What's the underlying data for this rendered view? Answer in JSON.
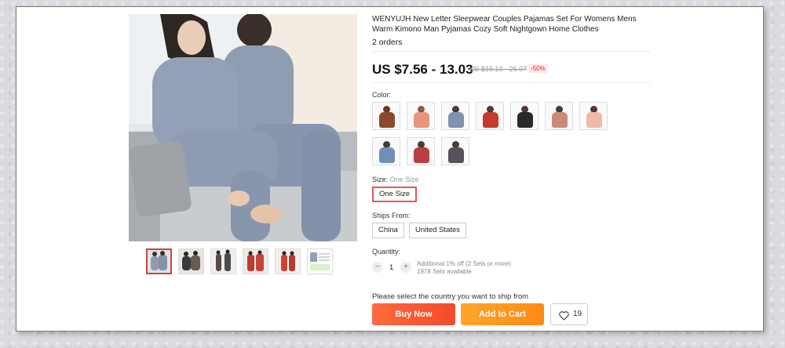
{
  "product": {
    "title": "WENYUJH New Letter Sleepwear Couples Pajamas Set For Womens Mens Warm Kimono Man Pyjamas Cozy Soft Nightgown Home Clothes",
    "orders": "2 orders",
    "price": "US $7.56 - 13.03",
    "original_price": "US $15.13 - 26.07",
    "discount": "-50%"
  },
  "color": {
    "label": "Color:",
    "swatches": [
      {
        "name": "brown",
        "color": "#8a4a2a"
      },
      {
        "name": "salmon",
        "color": "#e8957a"
      },
      {
        "name": "blue-grey",
        "color": "#7e93ad"
      },
      {
        "name": "red",
        "color": "#c43a2b"
      },
      {
        "name": "black",
        "color": "#2a2a2a"
      },
      {
        "name": "pink-beige",
        "color": "#c98b78"
      },
      {
        "name": "light-pink",
        "color": "#efb9a8"
      },
      {
        "name": "blue",
        "color": "#6f8fb8"
      },
      {
        "name": "wine-red",
        "color": "#b8403e"
      },
      {
        "name": "dark-grey",
        "color": "#55525a"
      }
    ]
  },
  "size": {
    "label": "Size:",
    "selected": "One Size",
    "options": [
      "One Size"
    ]
  },
  "ships_from": {
    "label": "Ships From:",
    "options": [
      "China",
      "United States"
    ]
  },
  "quantity": {
    "label": "Quantity:",
    "minus": "−",
    "value": "1",
    "plus": "+",
    "offer": "Additional 1% off (2 Sets or more)",
    "available": "1978 Sets available"
  },
  "ship_message": "Please select the country you want to ship from",
  "actions": {
    "buy_now": "Buy Now",
    "add_to_cart": "Add to Cart",
    "wishlist_count": "19"
  },
  "thumbnails": [
    {
      "name": "grey-couple"
    },
    {
      "name": "dark-couple"
    },
    {
      "name": "couple-standing"
    },
    {
      "name": "red-couple"
    },
    {
      "name": "red-pair"
    },
    {
      "name": "size-chart"
    }
  ]
}
